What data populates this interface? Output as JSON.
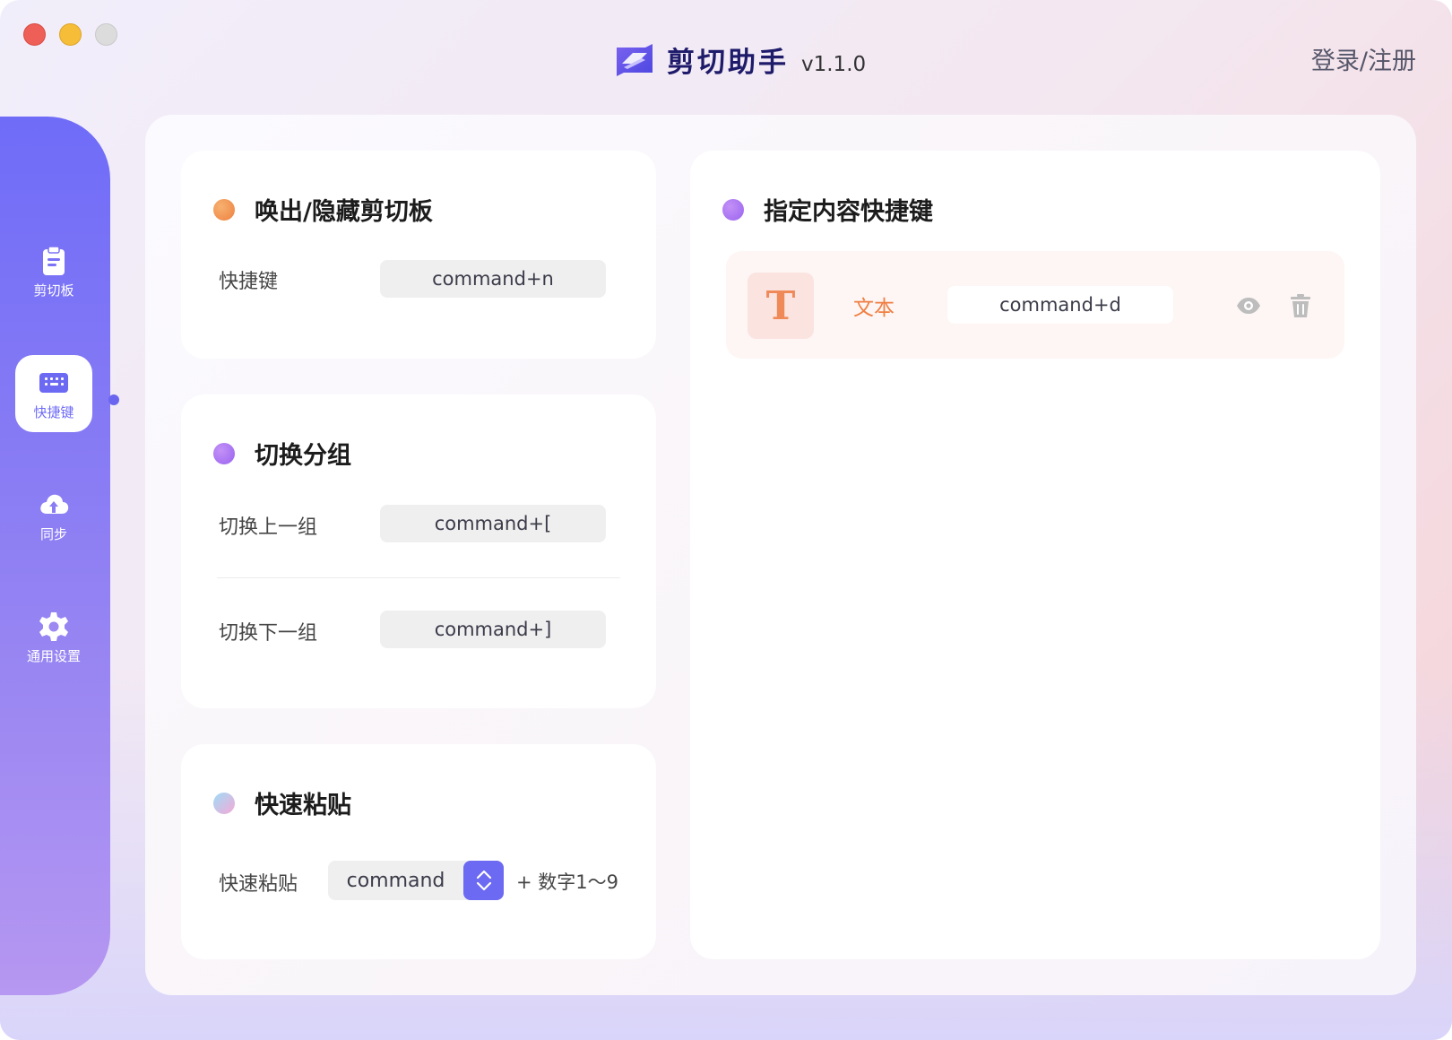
{
  "app": {
    "name": "剪切助手",
    "version": "v1.1.0",
    "login_label": "登录/注册"
  },
  "sidebar": {
    "items": [
      {
        "label": "剪切板",
        "icon": "clipboard-icon"
      },
      {
        "label": "快捷键",
        "icon": "keyboard-icon",
        "active": true
      },
      {
        "label": "同步",
        "icon": "cloud-upload-icon"
      },
      {
        "label": "通用设置",
        "icon": "gear-icon"
      }
    ]
  },
  "cards": {
    "toggle": {
      "title": "唤出/隐藏剪切板",
      "rows": [
        {
          "label": "快捷键",
          "shortcut": "command+n"
        }
      ]
    },
    "switch_group": {
      "title": "切换分组",
      "rows": [
        {
          "label": "切换上一组",
          "shortcut": "command+["
        },
        {
          "label": "切换下一组",
          "shortcut": "command+]"
        }
      ]
    },
    "quick_paste": {
      "title": "快速粘贴",
      "label": "快速粘贴",
      "modifier": "command",
      "suffix": "+ 数字1～9"
    },
    "content_shortcuts": {
      "title": "指定内容快捷键",
      "items": [
        {
          "type_glyph": "T",
          "type_label": "文本",
          "shortcut": "command+d"
        }
      ]
    }
  },
  "colors": {
    "accent": "#6c69f2",
    "orange_dot": "#f08a4b",
    "purple_dot": "#a06cf2",
    "text_type": "#f07f43"
  }
}
